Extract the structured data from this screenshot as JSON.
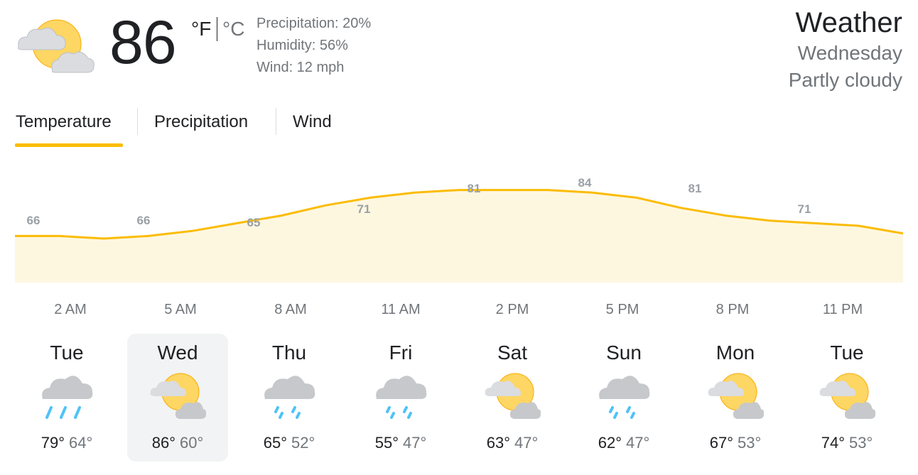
{
  "current": {
    "temperature": "86",
    "unit_f": "°F",
    "unit_c": "°C",
    "icon": "partly-cloudy-icon",
    "precipitation": "Precipitation: 20%",
    "humidity": "Humidity: 56%",
    "wind": "Wind: 12 mph"
  },
  "header": {
    "title": "Weather",
    "day": "Wednesday",
    "condition": "Partly cloudy"
  },
  "tabs": [
    {
      "label": "Temperature",
      "active": true
    },
    {
      "label": "Precipitation",
      "active": false
    },
    {
      "label": "Wind",
      "active": false
    }
  ],
  "chart_data": {
    "type": "area",
    "x": [
      "2 AM",
      "5 AM",
      "8 AM",
      "11 AM",
      "2 PM",
      "5 PM",
      "8 PM",
      "11 PM"
    ],
    "labels": [
      "66",
      "66",
      "65",
      "71",
      "81",
      "84",
      "81",
      "71"
    ],
    "series": [
      {
        "values": [
          66,
          66,
          65,
          66,
          68,
          71,
          74,
          78,
          81,
          83,
          84,
          84,
          84,
          83,
          81,
          77,
          74,
          72,
          71,
          70,
          67
        ]
      }
    ],
    "colors": {
      "line": "#fbbc04",
      "fill": "#fef7e0",
      "label": "#9aa0a6"
    }
  },
  "hours": [
    "2 AM",
    "5 AM",
    "8 AM",
    "11 AM",
    "2 PM",
    "5 PM",
    "8 PM",
    "11 PM"
  ],
  "forecast": [
    {
      "day": "Tue",
      "icon": "rain-icon",
      "high": "79°",
      "low": "64°",
      "selected": false
    },
    {
      "day": "Wed",
      "icon": "partly-cloudy-icon",
      "high": "86°",
      "low": "60°",
      "selected": true
    },
    {
      "day": "Thu",
      "icon": "showers-icon",
      "high": "65°",
      "low": "52°",
      "selected": false
    },
    {
      "day": "Fri",
      "icon": "showers-icon",
      "high": "55°",
      "low": "47°",
      "selected": false
    },
    {
      "day": "Sat",
      "icon": "partly-cloudy-icon",
      "high": "63°",
      "low": "47°",
      "selected": false
    },
    {
      "day": "Sun",
      "icon": "showers-icon",
      "high": "62°",
      "low": "47°",
      "selected": false
    },
    {
      "day": "Mon",
      "icon": "partly-cloudy-icon",
      "high": "67°",
      "low": "53°",
      "selected": false
    },
    {
      "day": "Tue",
      "icon": "partly-cloudy-icon",
      "high": "74°",
      "low": "53°",
      "selected": false
    }
  ],
  "colors": {
    "accent": "#fbbc04",
    "sun": "#fdd663",
    "cloud": "#d2d4d7",
    "rain": "#4fc3f7",
    "selected_bg": "#f1f3f4"
  }
}
